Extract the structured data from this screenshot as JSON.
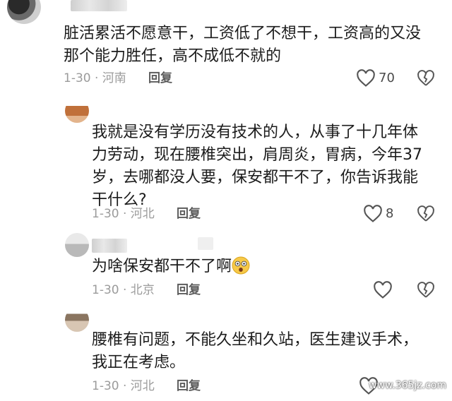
{
  "comments": [
    {
      "text": "脏活累活不愿意干，工资低了不想干，工资高的又没\n那个能力胜任，高不成低不就的",
      "meta": "1-30 · 河南",
      "reply": "回复",
      "likes": "70"
    },
    {
      "text": "我就是没有学历没有技术的人，从事了十几年体\n力劳动，现在腰椎突出，肩周炎，胃病，今年37\n岁，去哪都没人要，保安都干不了，你告诉我能\n干什么?",
      "meta": "1-30 · 河北",
      "reply": "回复",
      "likes": "8"
    },
    {
      "text": "为啥保安都干不了啊",
      "emoji": "astonished-face",
      "meta": "1-30 · 北京",
      "reply": "回复",
      "likes": ""
    },
    {
      "text": "腰椎有问题，不能久坐和久站，医生建议手术，\n我正在考虑。",
      "meta": "1-30 · 河北",
      "reply": "回复",
      "likes": ""
    }
  ],
  "watermark": "www.365jz.com",
  "colors": {
    "text": "#1c1c1c",
    "meta": "#9b9b9b",
    "icon": "#555555"
  }
}
